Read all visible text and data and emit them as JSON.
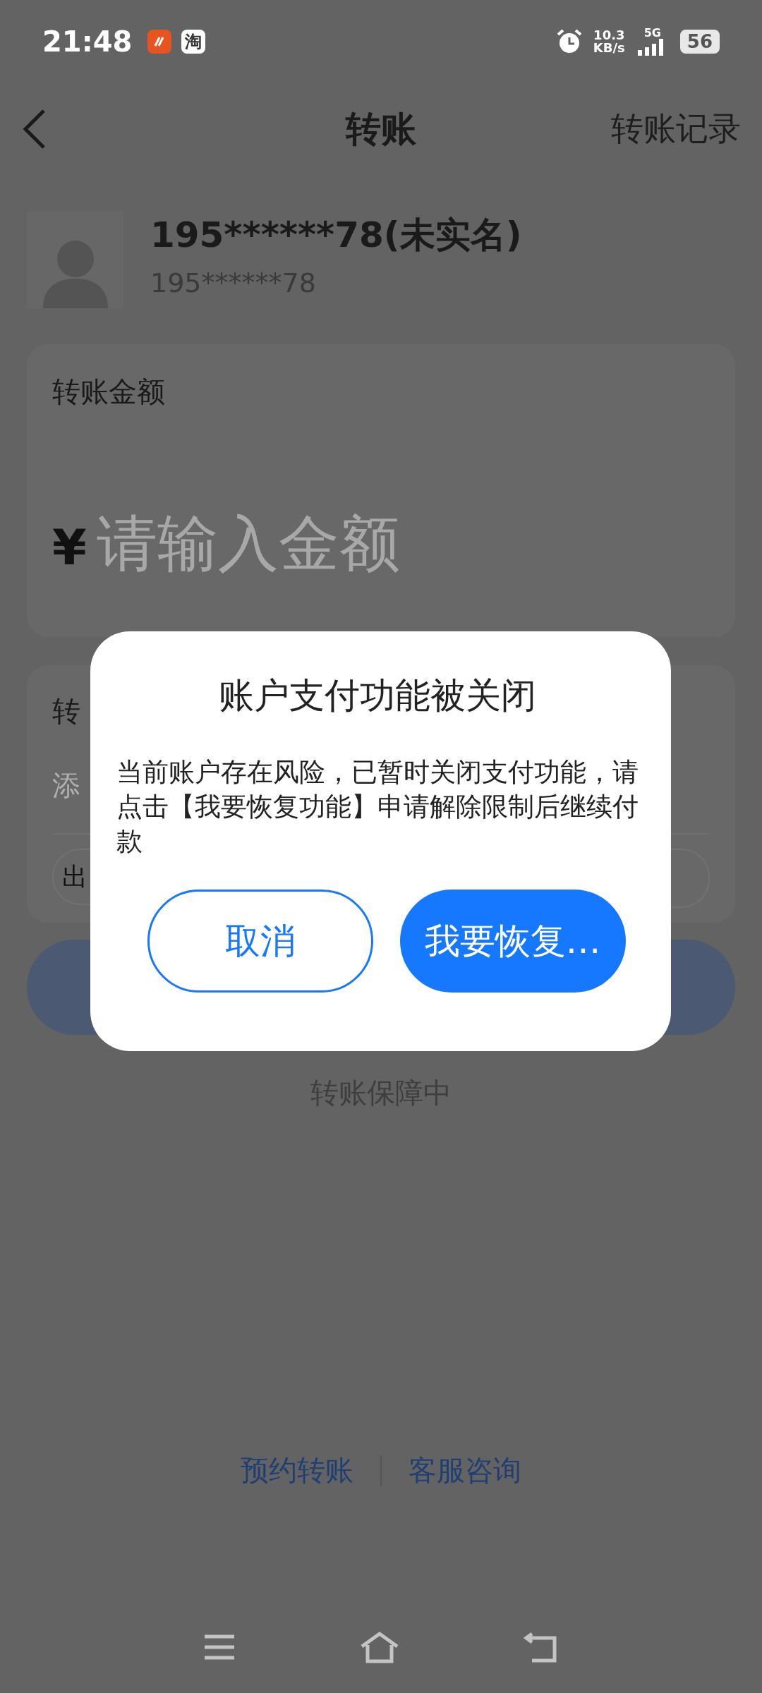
{
  "status_bar": {
    "time": "21:48",
    "app_badges": [
      {
        "kind": "logo"
      },
      {
        "kind": "text",
        "text": "淘"
      }
    ],
    "speed": "10.3",
    "speed_unit": "KB/s",
    "network": "5G",
    "battery": "56"
  },
  "nav": {
    "title": "转账",
    "action": "转账记录"
  },
  "recipient": {
    "name": "195******78(未实名)",
    "account": "195******78"
  },
  "amount_card": {
    "label": "转账金额",
    "currency": "¥",
    "placeholder": "请输入金额"
  },
  "note_card": {
    "label": "转",
    "note_placeholder": "添",
    "chip": "出"
  },
  "guarantee": "转账保障中",
  "links": [
    "预约转账",
    "客服咨询"
  ],
  "dialog": {
    "title": "账户支付功能被关闭",
    "message": "当前账户存在风险，已暂时关闭支付功能，请点击【我要恢复功能】申请解除限制后继续付款",
    "buttons": [
      {
        "label": "取消",
        "kind": "outline"
      },
      {
        "label": "我要恢复…",
        "kind": "primary"
      }
    ]
  }
}
